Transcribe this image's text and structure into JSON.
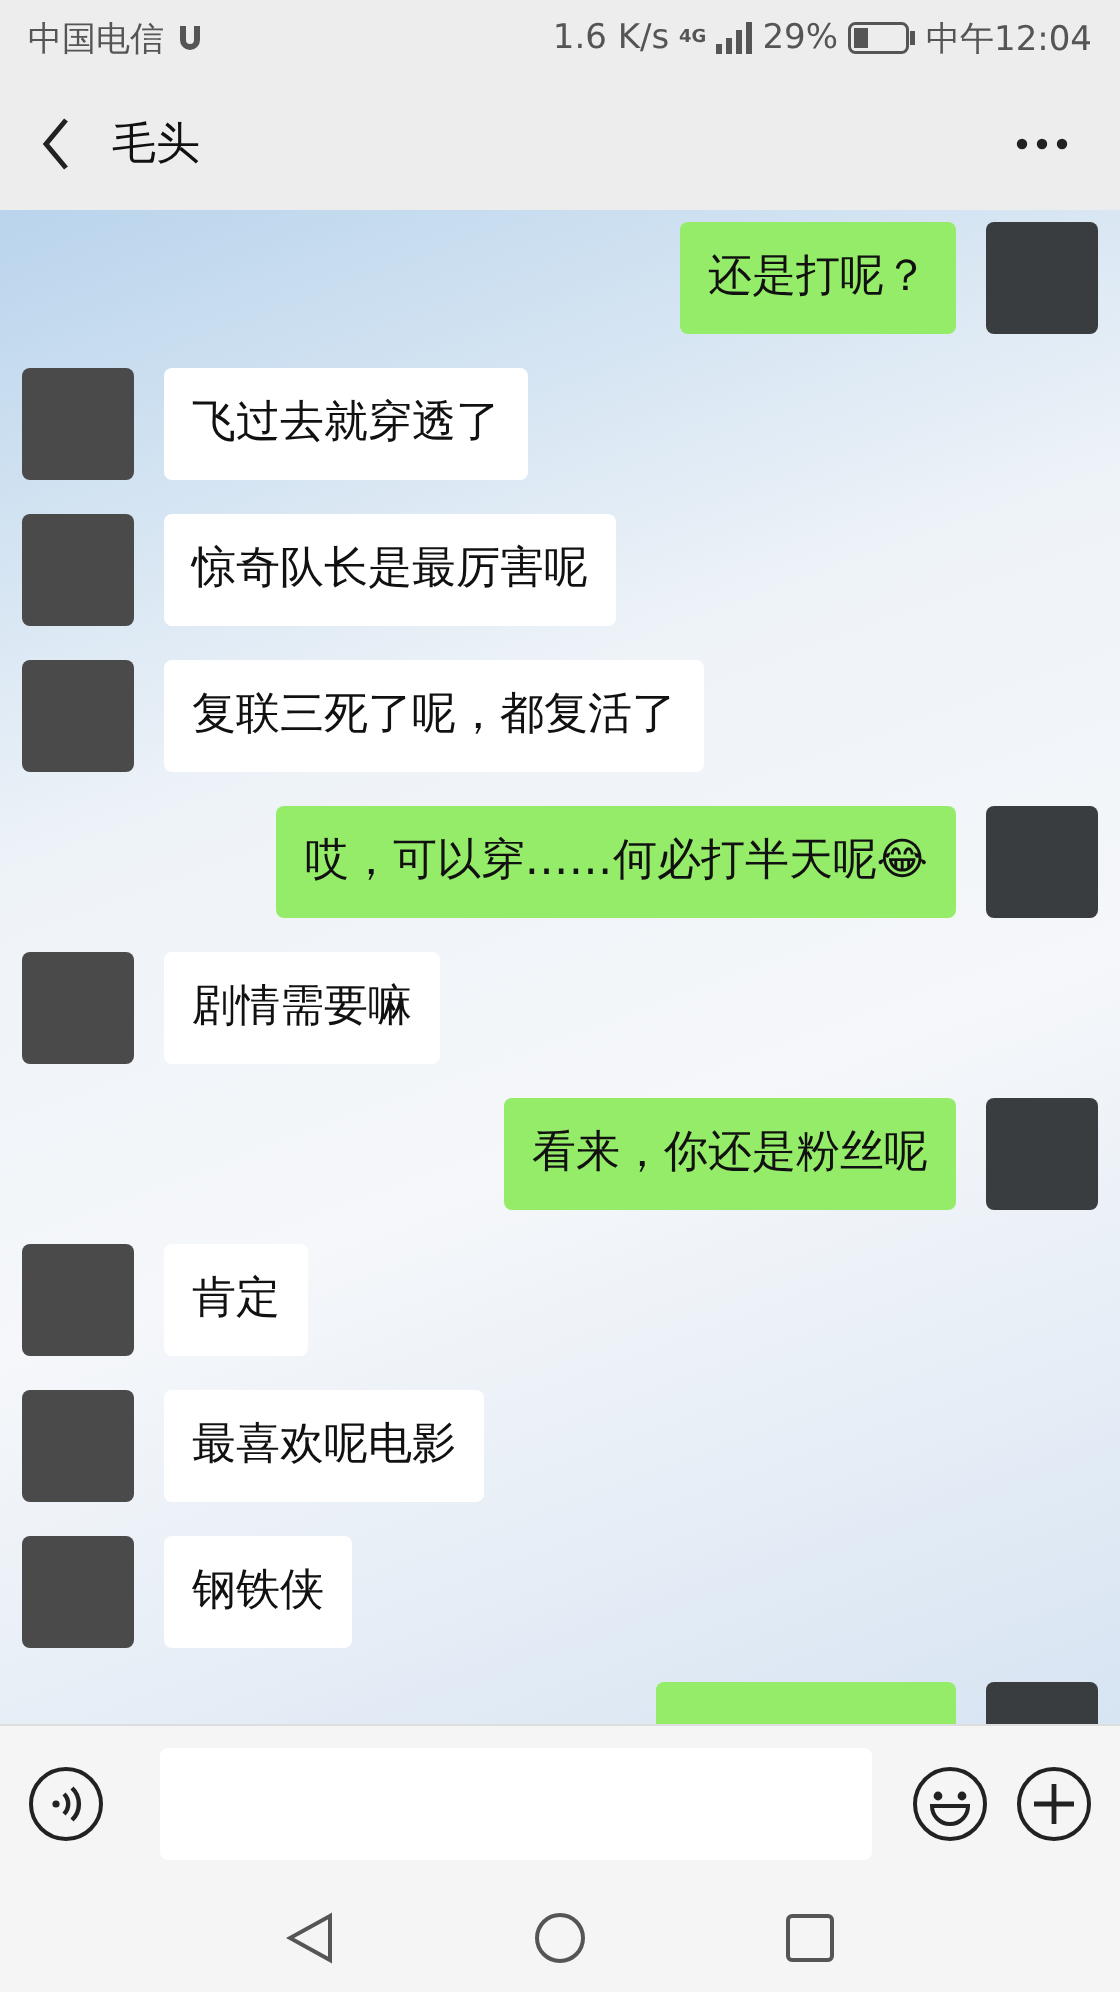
{
  "status_bar": {
    "carrier": "中国电信",
    "speed": "1.6 K/s",
    "network": "4G",
    "battery": "29%",
    "time": "中午12:04"
  },
  "header": {
    "title": "毛头"
  },
  "messages": [
    {
      "kind": "sent",
      "text": "还是打呢？"
    },
    {
      "kind": "received",
      "text": "飞过去就穿透了"
    },
    {
      "kind": "received",
      "text": "惊奇队长是最厉害呢"
    },
    {
      "kind": "received",
      "text": "复联三死了呢，都复活了"
    },
    {
      "kind": "sent",
      "text": "哎，可以穿……何必打半天呢😂"
    },
    {
      "kind": "received",
      "text": "剧情需要嘛"
    },
    {
      "kind": "sent",
      "text": "看来，你还是粉丝呢"
    },
    {
      "kind": "received",
      "text": "肯定"
    },
    {
      "kind": "received",
      "text": "最喜欢呢电影"
    },
    {
      "kind": "received",
      "text": "钢铁侠"
    },
    {
      "kind": "sent"
    }
  ]
}
